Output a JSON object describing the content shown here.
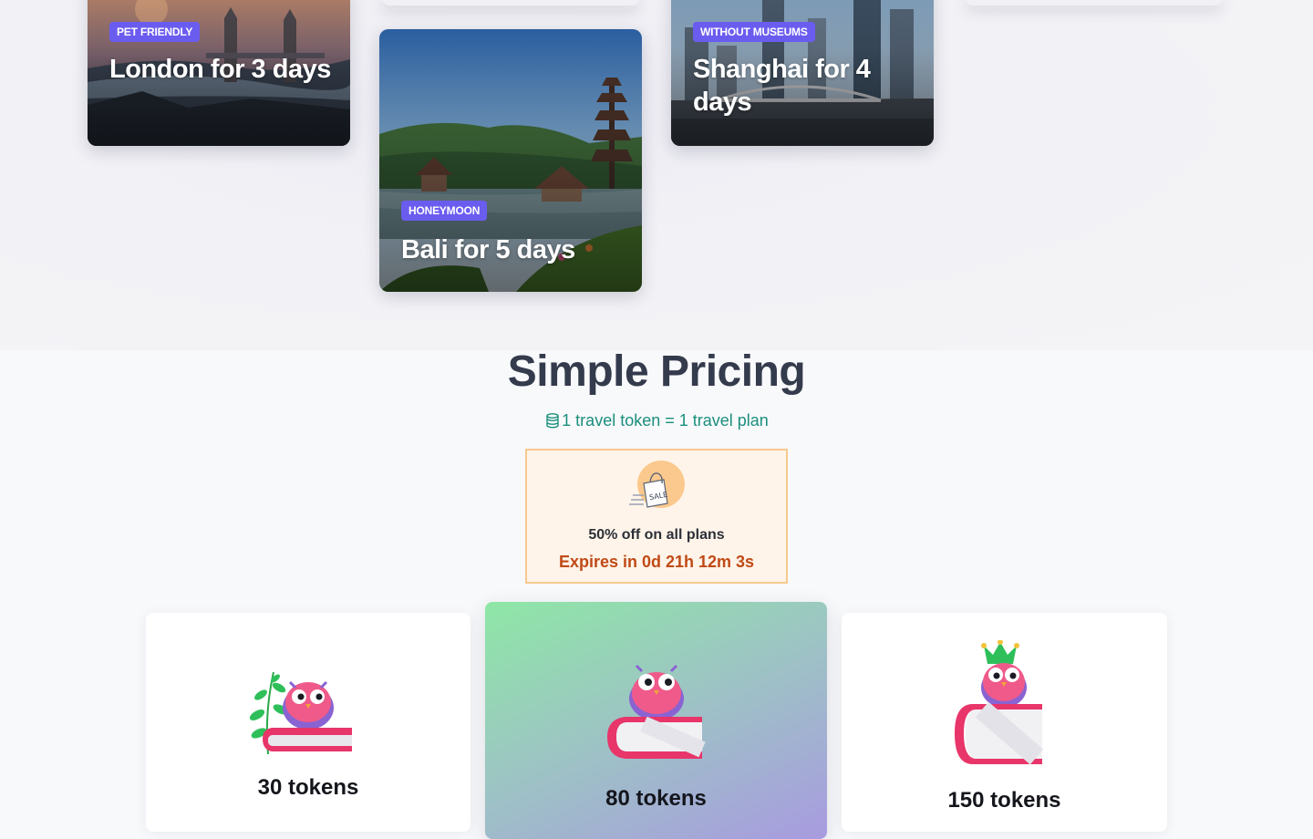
{
  "destinations": {
    "cards": [
      {
        "tag": "PET FRIENDLY",
        "title": "London for 3 days"
      },
      {
        "tag": "HONEYMOON",
        "title": "Bali for 5 days"
      },
      {
        "tag": "WITHOUT MUSEUMS",
        "title": "Shanghai for 4 days"
      }
    ]
  },
  "pricing": {
    "title": "Simple Pricing",
    "token_note": "1 travel token = 1 travel plan",
    "promo": {
      "icon": "sale-bag-icon",
      "icon_text": "SALE",
      "text": "50% off on all plans",
      "timer": "Expires in 0d 21h 12m 3s"
    },
    "plans": [
      {
        "tokens": "30 tokens",
        "art": "owl-on-book-with-plant"
      },
      {
        "tokens": "80 tokens",
        "art": "owl-on-book"
      },
      {
        "tokens": "150 tokens",
        "art": "owl-with-crown-on-book"
      }
    ]
  },
  "colors": {
    "tag_bg": "#6b5cf0",
    "title_text": "#343b4c",
    "token_note": "#1b8f7d",
    "promo_border": "#f7c98e",
    "promo_bg": "#fff4e9",
    "timer_text": "#c04a16"
  }
}
